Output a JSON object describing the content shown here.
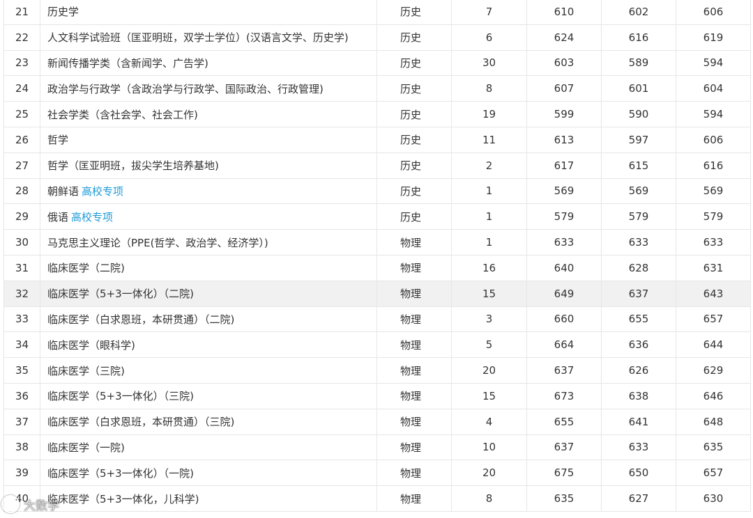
{
  "rows": [
    {
      "no": "21",
      "name": "历史学",
      "tag": "",
      "subject": "历史",
      "plan": "7",
      "max": "610",
      "min": "602",
      "avg": "606"
    },
    {
      "no": "22",
      "name": "人文科学试验班（匡亚明班，双学士学位）(汉语言文学、历史学)",
      "tag": "",
      "subject": "历史",
      "plan": "6",
      "max": "624",
      "min": "616",
      "avg": "619"
    },
    {
      "no": "23",
      "name": "新闻传播学类（含新闻学、广告学)",
      "tag": "",
      "subject": "历史",
      "plan": "30",
      "max": "603",
      "min": "589",
      "avg": "594"
    },
    {
      "no": "24",
      "name": "政治学与行政学（含政治学与行政学、国际政治、行政管理)",
      "tag": "",
      "subject": "历史",
      "plan": "8",
      "max": "607",
      "min": "601",
      "avg": "604"
    },
    {
      "no": "25",
      "name": "社会学类（含社会学、社会工作)",
      "tag": "",
      "subject": "历史",
      "plan": "19",
      "max": "599",
      "min": "590",
      "avg": "594"
    },
    {
      "no": "26",
      "name": "哲学",
      "tag": "",
      "subject": "历史",
      "plan": "11",
      "max": "613",
      "min": "597",
      "avg": "606"
    },
    {
      "no": "27",
      "name": "哲学（匡亚明班，拔尖学生培养基地)",
      "tag": "",
      "subject": "历史",
      "plan": "2",
      "max": "617",
      "min": "615",
      "avg": "616"
    },
    {
      "no": "28",
      "name": "朝鲜语",
      "tag": "高校专项",
      "subject": "历史",
      "plan": "1",
      "max": "569",
      "min": "569",
      "avg": "569"
    },
    {
      "no": "29",
      "name": "俄语",
      "tag": "高校专项",
      "subject": "历史",
      "plan": "1",
      "max": "579",
      "min": "579",
      "avg": "579"
    },
    {
      "no": "30",
      "name": "马克思主义理论（PPE(哲学、政治学、经济学）)",
      "tag": "",
      "subject": "物理",
      "plan": "1",
      "max": "633",
      "min": "633",
      "avg": "633"
    },
    {
      "no": "31",
      "name": "临床医学（二院)",
      "tag": "",
      "subject": "物理",
      "plan": "16",
      "max": "640",
      "min": "628",
      "avg": "631"
    },
    {
      "no": "32",
      "name": "临床医学（5+3一体化）（二院)",
      "tag": "",
      "subject": "物理",
      "plan": "15",
      "max": "649",
      "min": "637",
      "avg": "643"
    },
    {
      "no": "33",
      "name": "临床医学（白求恩班，本研贯通）（二院)",
      "tag": "",
      "subject": "物理",
      "plan": "3",
      "max": "660",
      "min": "655",
      "avg": "657"
    },
    {
      "no": "34",
      "name": "临床医学（眼科学)",
      "tag": "",
      "subject": "物理",
      "plan": "5",
      "max": "664",
      "min": "636",
      "avg": "644"
    },
    {
      "no": "35",
      "name": "临床医学（三院)",
      "tag": "",
      "subject": "物理",
      "plan": "20",
      "max": "637",
      "min": "626",
      "avg": "629"
    },
    {
      "no": "36",
      "name": "临床医学（5+3一体化）（三院)",
      "tag": "",
      "subject": "物理",
      "plan": "15",
      "max": "673",
      "min": "638",
      "avg": "646"
    },
    {
      "no": "37",
      "name": "临床医学（白求恩班，本研贯通）（三院)",
      "tag": "",
      "subject": "物理",
      "plan": "4",
      "max": "655",
      "min": "641",
      "avg": "648"
    },
    {
      "no": "38",
      "name": "临床医学（一院)",
      "tag": "",
      "subject": "物理",
      "plan": "10",
      "max": "637",
      "min": "633",
      "avg": "635"
    },
    {
      "no": "39",
      "name": "临床医学（5+3一体化）（一院)",
      "tag": "",
      "subject": "物理",
      "plan": "20",
      "max": "675",
      "min": "650",
      "avg": "657"
    },
    {
      "no": "40",
      "name": "临床医学（5+3一体化，儿科学)",
      "tag": "",
      "subject": "物理",
      "plan": "8",
      "max": "635",
      "min": "627",
      "avg": "630"
    }
  ],
  "highlight_row": "32",
  "watermark": "大数学",
  "colors": {
    "tag": "#1e9bd7",
    "border": "#e6e6e6",
    "stripe": "#f6f6f6",
    "text": "#333333"
  }
}
